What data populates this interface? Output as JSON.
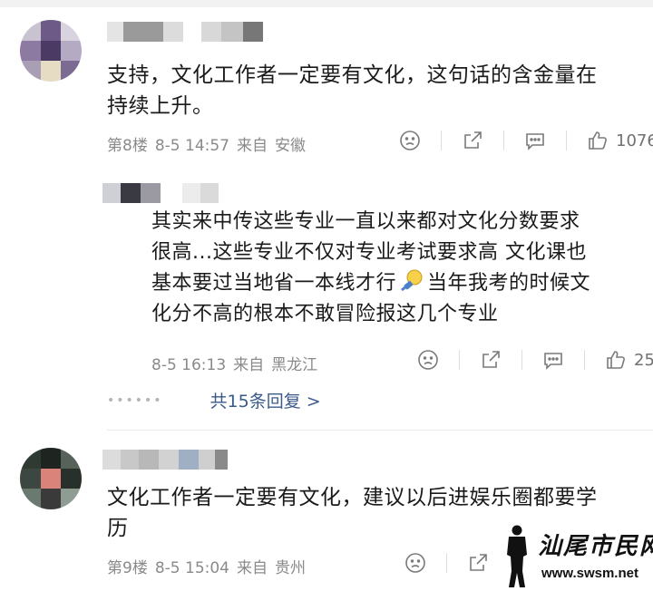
{
  "comments": [
    {
      "text_line1": "支持，文化工作者一定要有文化，这句话的含金量在",
      "text_line2": "持续上升。",
      "floor": "第8楼",
      "date": "8-5 14:57",
      "location_prefix": "来自",
      "location": "安徽",
      "like_count": "1076",
      "reply": {
        "text_line1": "其实来中传这些专业一直以来都对文化分数要求",
        "text_line2": "很高...这些专业不仅对专业考试要求高 文化课也",
        "text_line3a": "基本要过当地省一本线才行",
        "text_line3b": "当年我考的时候文",
        "text_line4": "化分不高的根本不敢冒险报这几个专业",
        "date": "8-5 16:13",
        "location_prefix": "来自",
        "location": "黑龙江",
        "like_count": "25"
      },
      "more_replies": "共15条回复 >"
    },
    {
      "text_line1": "文化工作者一定要有文化，建议以后进娱乐圈都要学",
      "text_line2": "历",
      "floor": "第9楼",
      "date": "8-5 15:04",
      "location_prefix": "来自",
      "location": "贵州"
    }
  ],
  "icons": {
    "dislike": "sad-face-icon",
    "share": "share-icon",
    "reply": "comment-bubble-icon",
    "like": "thumbs-up-icon",
    "inline_emoji": "bulb-emoji-icon"
  },
  "watermark": {
    "title": "汕尾市民网",
    "url": "www.swsm.net"
  },
  "colors": {
    "meta_text": "#8a8a8a",
    "link_blue": "#3b5a8c",
    "body_text": "#1a1a1a"
  }
}
